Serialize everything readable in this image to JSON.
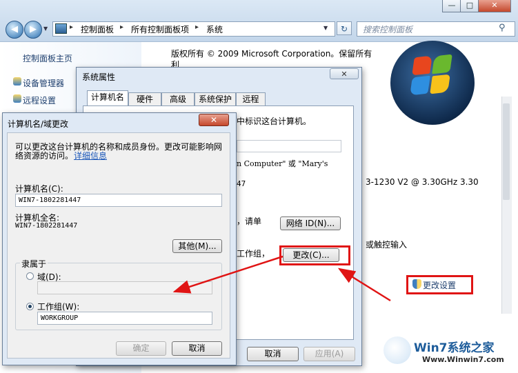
{
  "explorer": {
    "breadcrumb": [
      "控制面板",
      "所有控制面板项",
      "系统"
    ],
    "search_placeholder": "搜索控制面板",
    "window_buttons": {
      "minimize": "—",
      "maximize": "□",
      "close": "✕"
    }
  },
  "left_pane": {
    "home_link": "控制面板主页",
    "links": [
      "设备管理器",
      "远程设置"
    ]
  },
  "system_page": {
    "copyright_line1": "版权所有 © 2009 Microsoft Corporation。保留所有",
    "copyright_line2": "利",
    "processor_text": "3-1230 V2 @ 3.30GHz   3.30",
    "touch_text": "或触控输入",
    "change_settings": "更改设置"
  },
  "system_properties": {
    "title": "系统属性",
    "tabs": [
      "计算机名",
      "硬件",
      "高级",
      "系统保护",
      "远程"
    ],
    "identify_text": "中标识这台计算机。",
    "example_text": "n Computer\" 或 \"Mary's",
    "name_fragment": "47",
    "join_text": "，请单",
    "network_id_button": "网络 ID(N)...",
    "workgroup_text": "工作组，",
    "change_button": "更改(C)...",
    "cancel_button": "取消",
    "apply_button": "应用(A)"
  },
  "rename_dialog": {
    "title": "计算机名/域更改",
    "description_line1": "可以更改这台计算机的名称和成员身份。更改可能影响网",
    "description_line2": "络资源的访问。",
    "details_link": "详细信息",
    "computer_name_label": "计算机名(C):",
    "computer_name_value": "WIN7-1802281447",
    "full_name_label": "计算机全名:",
    "full_name_value": "WIN7-1802281447",
    "other_button": "其他(M)...",
    "member_of_label": "隶属于",
    "domain_label": "域(D):",
    "domain_value": "",
    "workgroup_label": "工作组(W):",
    "workgroup_value": "WORKGROUP",
    "selected_membership": "workgroup",
    "ok_button": "确定",
    "cancel_button": "取消"
  },
  "watermark": {
    "brand": "Win7系统之家",
    "url": "Www.Winwin7.com"
  },
  "colors": {
    "highlight_red": "#e01414",
    "link_blue": "#1e3f6e"
  }
}
